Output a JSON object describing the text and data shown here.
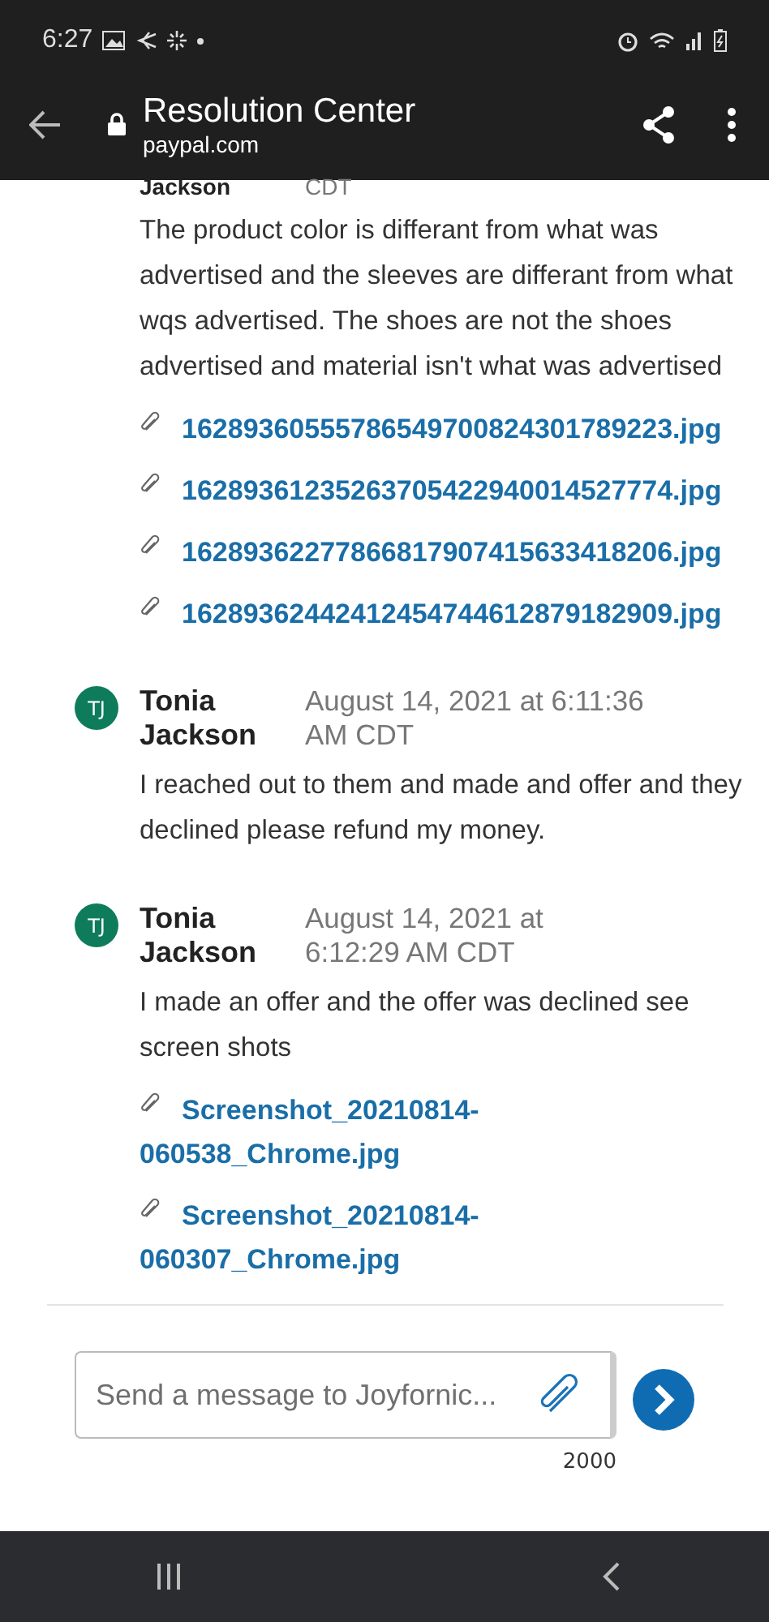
{
  "status_bar": {
    "time": "6:27"
  },
  "app_bar": {
    "title": "Resolution Center",
    "url": "paypal.com"
  },
  "messages": [
    {
      "name": "Jackson",
      "time": "CDT",
      "body": "The product color is differant from what was advertised and the sleeves are differant from what wqs advertised. The shoes are not the shoes advertised and material isn't what was advertised",
      "attachments": [
        "16289360555786549700824301789223.jpg",
        "16289361235263705422940014527774.jpg",
        "16289362277866817907415633418206.jpg",
        "16289362442412454744612879182909.jpg"
      ]
    },
    {
      "avatar": "TJ",
      "name": "Tonia Jackson",
      "time": "August 14, 2021 at 6:11:36 AM CDT",
      "body": "I reached out to them and made and offer and they declined please refund my money."
    },
    {
      "avatar": "TJ",
      "name": "Tonia Jackson",
      "time": "August 14, 2021 at 6:12:29 AM CDT",
      "body": "I made an offer and the offer was declined see screen shots",
      "attachments": [
        "Screenshot_20210814-060538_Chrome.jpg",
        "Screenshot_20210814-060307_Chrome.jpg"
      ]
    }
  ],
  "composer": {
    "placeholder": "Send a message to Joyfornic...",
    "counter": "2000"
  }
}
